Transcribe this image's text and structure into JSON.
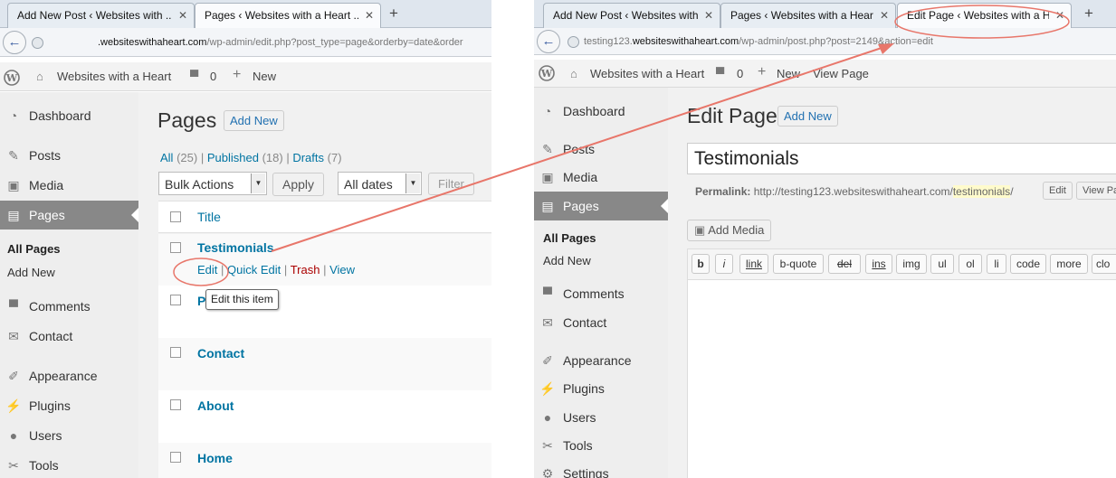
{
  "left": {
    "tabs": [
      "Add New Post ‹ Websites with ...",
      "Pages ‹ Websites with a Heart ..."
    ],
    "new_tab": "+",
    "url_domain": ".websiteswithaheart.com",
    "url_path": "/wp-admin/edit.php?post_type=page&orderby=date&order",
    "adminbar": {
      "site": "Websites with a Heart",
      "comments": "0",
      "new": "New"
    },
    "menu": {
      "dashboard": "Dashboard",
      "posts": "Posts",
      "media": "Media",
      "pages": "Pages",
      "all_pages": "All Pages",
      "add_new": "Add New",
      "comments": "Comments",
      "contact": "Contact",
      "appearance": "Appearance",
      "plugins": "Plugins",
      "users": "Users",
      "tools": "Tools"
    },
    "title": "Pages",
    "add_new_btn": "Add New",
    "filters": {
      "all": "All",
      "all_count": "(25)",
      "published": "Published",
      "published_count": "(18)",
      "drafts": "Drafts",
      "drafts_count": "(7)",
      "sep": "|"
    },
    "bulk_select": "Bulk Actions",
    "apply_btn": "Apply",
    "dates_select": "All dates",
    "filter_btn": "Filter",
    "col_title": "Title",
    "rows": [
      "Testimonials",
      "P",
      "Contact",
      "About",
      "Home"
    ],
    "row_actions": {
      "edit": "Edit",
      "quick_edit": "Quick Edit",
      "trash": "Trash",
      "view": "View",
      "sep": "|"
    },
    "tooltip": "Edit this item"
  },
  "right": {
    "tabs": [
      "Add New Post ‹ Websites with ...",
      "Pages ‹ Websites with a Heart ...",
      "Edit Page ‹ Websites with a Hea..."
    ],
    "new_tab": "+",
    "url_pre": "testing123.",
    "url_domain": "websiteswithaheart.com",
    "url_path": "/wp-admin/post.php?post=2149&action=edit",
    "adminbar": {
      "site": "Websites with a Heart",
      "comments": "0",
      "new": "New",
      "view_page": "View Page"
    },
    "menu": {
      "dashboard": "Dashboard",
      "posts": "Posts",
      "media": "Media",
      "pages": "Pages",
      "all_pages": "All Pages",
      "add_new": "Add New",
      "comments": "Comments",
      "contact": "Contact",
      "appearance": "Appearance",
      "plugins": "Plugins",
      "users": "Users",
      "tools": "Tools",
      "settings": "Settings"
    },
    "title": "Edit Page",
    "add_new_btn": "Add New",
    "post_title": "Testimonials",
    "permalink_label": "Permalink:",
    "permalink_base": "http://testing123.websiteswithaheart.com/",
    "permalink_slug": "testimonials",
    "permalink_end": "/",
    "edit_btn": "Edit",
    "view_btn": "View Pa",
    "add_media": "Add Media",
    "quicktags": [
      "b",
      "i",
      "link",
      "b-quote",
      "del",
      "ins",
      "img",
      "ul",
      "ol",
      "li",
      "code",
      "more",
      "clo"
    ]
  },
  "colors": {
    "annotation": "#e8766a",
    "link": "#0074a2",
    "trash": "#a00"
  }
}
